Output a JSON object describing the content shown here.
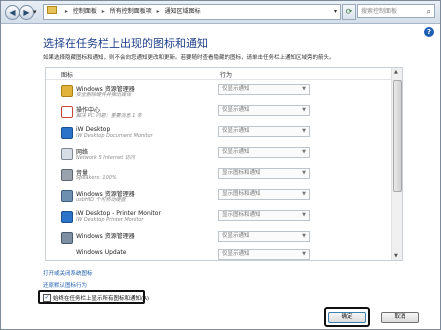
{
  "address": {
    "crumbs": [
      "控制面板",
      "所有控制面板项",
      "通知区域图标"
    ],
    "search_placeholder": "搜索控制面板"
  },
  "page": {
    "title": "选择在任务栏上出现的图标和通知",
    "description": "如果选择隐藏图标和通知，则不会向您通知更改和更新。若要随时查看隐藏的图标，请单击任务栏上通知区域旁的箭头。"
  },
  "columns": {
    "icon": "图标",
    "behavior": "行为"
  },
  "rows": [
    {
      "name": "Windows 资源管理器",
      "sub": "安全删除硬件并弹出媒体",
      "behavior": "仅显示通知"
    },
    {
      "name": "操作中心",
      "sub": "解决 PC 问题：重要消息 1 条",
      "behavior": "仅显示通知"
    },
    {
      "name": "iW Desktop",
      "sub": "iW Desktop Document Monitor",
      "behavior": "仅显示通知"
    },
    {
      "name": "网络",
      "sub": "Network 5 Internet 访问",
      "behavior": "仅显示通知"
    },
    {
      "name": "音量",
      "sub": "Speakers: 100%",
      "behavior": "显示图标和通知"
    },
    {
      "name": "Windows 资源管理器",
      "sub": "usbHID 个可移动硬盘",
      "behavior": "显示图标和通知"
    },
    {
      "name": "iW Desktop - Printer Monitor",
      "sub": "iW Desktop Printer Monitor",
      "behavior": "显示图标和通知"
    },
    {
      "name": "Windows 资源管理器",
      "sub": "",
      "behavior": "仅显示通知"
    },
    {
      "name": "Windows Update",
      "sub": "",
      "behavior": "仅显示通知"
    }
  ],
  "links": {
    "system_icons": "打开或关闭系统图标",
    "restore_defaults": "还原默认图标行为"
  },
  "checkbox": {
    "label": "始终在任务栏上显示所有图标和通知(A)",
    "checked": "✓"
  },
  "buttons": {
    "ok": "确定",
    "cancel": "取消"
  },
  "icons": {
    "back": "back-arrow-icon",
    "forward": "forward-arrow-icon",
    "refresh": "refresh-icon",
    "search": "search-icon",
    "help": "help-icon"
  }
}
